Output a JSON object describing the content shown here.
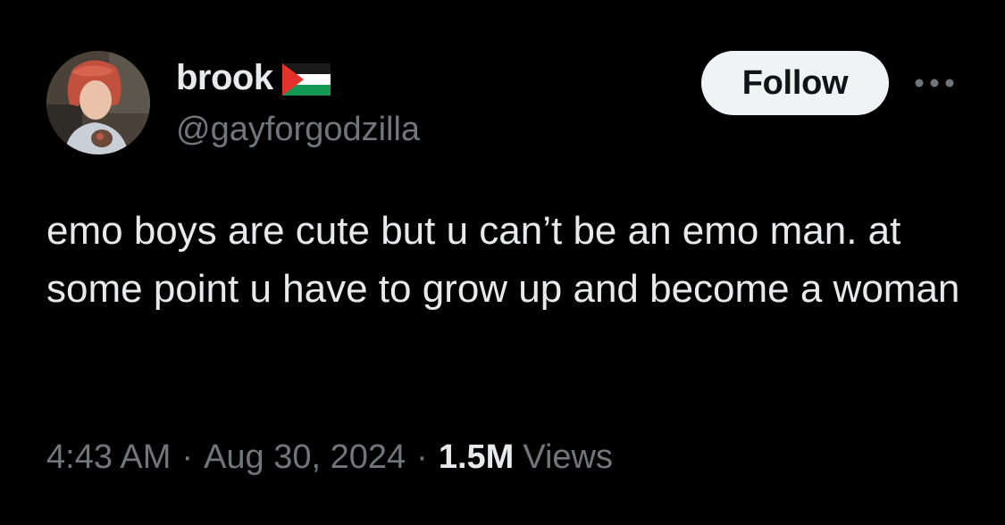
{
  "tweet": {
    "author": {
      "display_name": "brook",
      "handle": "@gayforgodzilla",
      "flag_icon": "palestine-flag-icon"
    },
    "follow_label": "Follow",
    "more_icon": "more-horizontal-icon",
    "text": "emo boys are cute but u can’t be an emo man. at some point u have to grow up and become a woman",
    "time": "4:43 AM",
    "separator": "·",
    "date": "Aug 30, 2024",
    "views_count": "1.5M",
    "views_label": "Views"
  },
  "colors": {
    "background": "#000000",
    "primary_text": "#e7e9ea",
    "secondary_text": "#71767b",
    "follow_button_bg": "#eff3f4",
    "follow_button_text": "#0f1419"
  }
}
